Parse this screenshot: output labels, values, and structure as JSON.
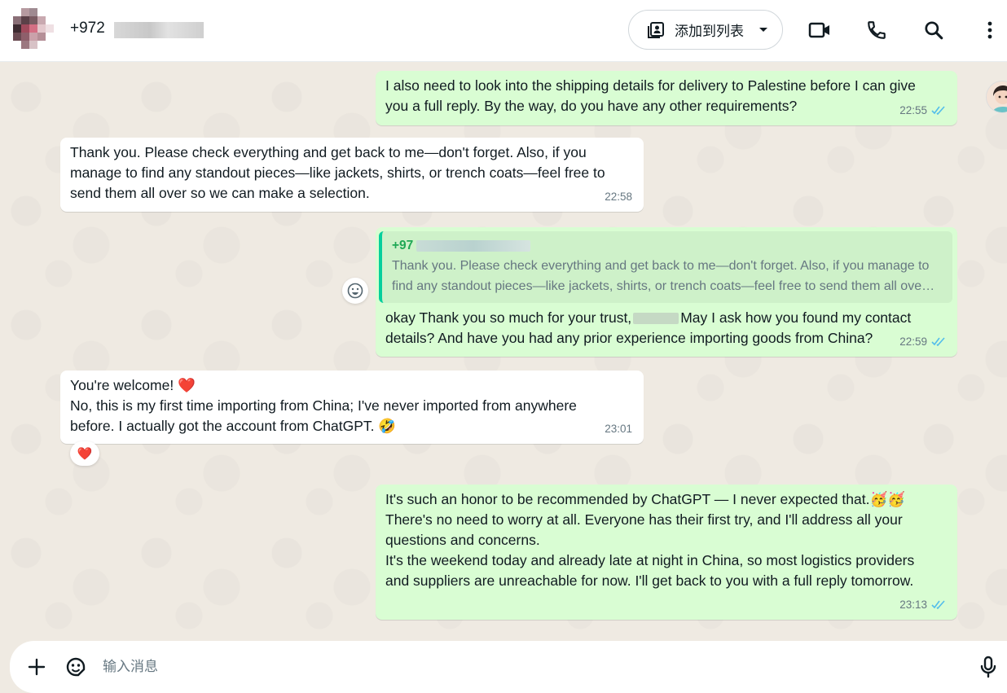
{
  "header": {
    "contact_number": "+972",
    "add_to_list_label": "添加到列表",
    "icons": [
      "video-call-icon",
      "voice-call-icon",
      "search-icon",
      "more-options-icon"
    ]
  },
  "messages": [
    {
      "direction": "out",
      "lines": [
        "I also need to look into the shipping details for delivery to Palestine before I can give",
        "you a full reply. By the way, do you have any other requirements?"
      ],
      "time": "22:55",
      "status": "read"
    },
    {
      "direction": "in",
      "lines": [
        "Thank you. Please check everything and get back to me—don't forget. Also, if you",
        "manage to find any standout pieces—like jackets, shirts, or trench coats—feel free to",
        "send them all over so we can make a selection."
      ],
      "time": "22:58"
    },
    {
      "direction": "out",
      "quote": {
        "author": "+97",
        "lines": [
          "Thank you. Please check everything and get back to me—don't forget. Also, if you manage to",
          "find any standout pieces—like jackets, shirts, or trench coats—feel free to send them all ove…"
        ]
      },
      "lines_part1": "okay Thank you so much for your trust,",
      "lines_part2": "May I ask how you found my contact",
      "line2": "details? And have you had any prior experience importing goods from China?",
      "time": "22:59",
      "status": "read"
    },
    {
      "direction": "in",
      "lines": [
        "You're welcome! ❤️",
        "No, this is my first time importing from China; I've never imported from anywhere",
        "before. I actually got the account from ChatGPT. 🤣"
      ],
      "time": "23:01",
      "reaction": "❤️"
    },
    {
      "direction": "out",
      "lines": [
        "It's such an honor to be recommended by ChatGPT — I never expected that.🥳🥳",
        "There's no need to worry at all. Everyone has their first try, and I'll address all your",
        "questions and concerns.",
        "It's the weekend today and already late at night in China, so most logistics providers",
        "and suppliers are unreachable for now. I'll get back to you with a full reply tomorrow."
      ],
      "time": "23:13",
      "status": "read"
    }
  ],
  "composer": {
    "placeholder": "输入消息"
  },
  "colors": {
    "out_bubble": "#d9fdd3",
    "in_bubble": "#ffffff",
    "chat_bg": "#efeae2",
    "read_ticks": "#53bdeb"
  }
}
